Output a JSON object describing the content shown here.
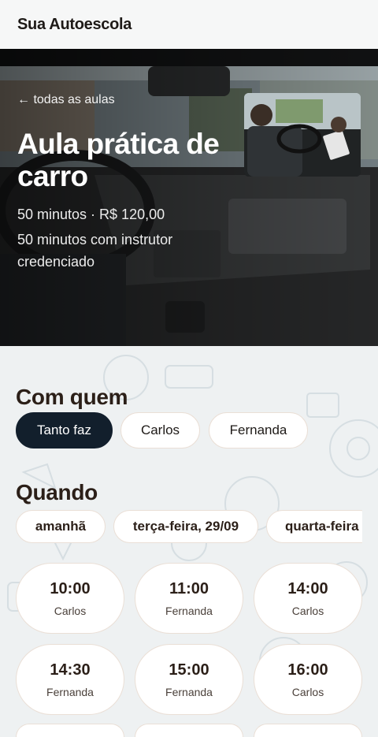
{
  "header": {
    "brand": "Sua Autoescola"
  },
  "hero": {
    "back_link": "← todas as aulas",
    "title": "Aula prática de carro",
    "meta": "50 minutos · R$ 120,00",
    "description": "50 minutos com instrutor credenciado"
  },
  "instructors": {
    "title": "Com quem",
    "options": [
      "Tanto faz",
      "Carlos",
      "Fernanda"
    ],
    "selected": "Tanto faz"
  },
  "schedule": {
    "title": "Quando",
    "dates": [
      "amanhã",
      "terça-feira, 29/09",
      "quarta-feira"
    ],
    "slots": [
      {
        "time": "10:00",
        "instructor": "Carlos"
      },
      {
        "time": "11:00",
        "instructor": "Fernanda"
      },
      {
        "time": "14:00",
        "instructor": "Carlos"
      },
      {
        "time": "14:30",
        "instructor": "Fernanda"
      },
      {
        "time": "15:00",
        "instructor": "Fernanda"
      },
      {
        "time": "16:00",
        "instructor": "Carlos"
      }
    ]
  },
  "colors": {
    "accent": "#121f2c",
    "background": "#eef1f2",
    "chip_border": "#eadfd6"
  }
}
